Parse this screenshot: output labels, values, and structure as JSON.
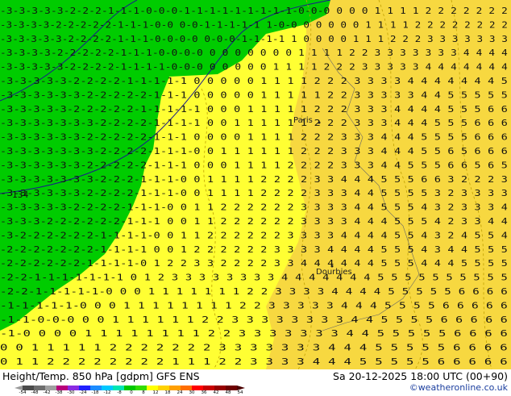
{
  "map": {
    "rows": [
      "-3-3-3-3-3-2-2-2-1-1-1-0-0-0-1-1-1-1-1-1-1-1-1-0-0-0 0 0 0 1 1 1 1 2 2 2 2 2 2 2",
      "-3-3-3-3-2-2-2-2-2-1-1-1-0-0 0-0-1-1-1-1-1 1-0-0 0 0 0 0 0 1 1 1 1 2 2 2 2 2 2 2 2",
      "-3-3-3-3-3-2-2-2-2-1-1-1-0-0-0-0 0-0-0-1-1-1-1 1 0 0 0 0 1 1 1 2 2 2 3 3 3 3 3 3 3",
      "-3-3-3-3-2-2-2-2-2-1-1-1-0-0-0-0 0 0 0 0 0 0 0 1 1 1 1 2 2 3 3 3 3 3 3 3 4 4 4 4",
      "-3-3-3-3-3-2-2-2-2-1-1-1-1-0-0-0 0 0 0 0 0 1 1 1 1 2 2 2 3 3 3 3 3 4 4 4 4 4 4 4",
      "-3-3-3-3-3-2-2-2-2-1-1-1-1-1 0 0 0 0 0 1 1 1 1 2 2 2 3 3 3 3 4 4 4 4 4 4 4 5",
      "-3-3-3-3-3-3-2-2-2-2-2-1-1-1 0 0 0 0 0 1 1 1 1 1 2 2 3 3 3 3 3 4 4 5 5 5 5 5",
      "-3-3-3-3-3-2-2-2-2-2-1-1-1-1-1 0 0 0 1 1 1 1 1 2 2 2 3 3 3 4 4 4 4 5 5 5 6 6",
      "-3-3-3-3-3-3-3-2-2-2-2-1-1-1-1 0 0 1 1 1 1 1 1 2 2 2 3 3 3 4 4 4 5 5 5 6 6 6",
      "-3-3-3-3-3-3-2-2-2-2-2-1-1-1 0 0 0 0 1 1 1 1 2 2 2 3 3 3 4 4 4 5 5 5 5 6 6 6",
      "-3-3-3-3-3-3-3-2-2-2-2-1-1-1-0 0 1 1 1 1 1 1 2 2 2 3 3 3 4 4 4 5 5 6 5 6 6 6",
      "-3-3-3-3-3-3-2-2-2-2-2-1-1-1 0 0 0 1 1 1 1 2 2 2 2 3 3 3 4 4 5 5 5 6 6 5 6 5",
      "-3-3-3-3-3-3-3-2-2-2-1-1-1-0 0 1 1 1 1 2 2 2 2 3 3 4 4 4 5 5 5 6 6 3 2 2 2 3",
      "-3-3-3-3-3-3-2-2-2-2-1-1-1-0 0 1 1 1 1 2 2 2 2 3 3 3 4 4 5 5 5 5 3 2 3 3 3 3",
      "-3-3-3-3-3-2-2-2-2-1-1-1-0 0 1 1 2 2 2 2 2 2 3 3 3 3 4 4 5 5 5 4 3 2 3 3 3 4",
      "-3-3-3-2-2-2-2-2-2-1-1-1 0 0 1 1 2 2 2 2 2 2 3 3 3 3 4 4 4 5 5 5 4 2 3 3 4 4",
      "-3-2-2-2-2-2-2-1-1-1-1-0 0 1 1 2 2 2 2 2 2 3 3 3 3 4 4 4 4 5 5 4 3 2 4 5 5 4",
      "-2-2-2-2-2-2-2-1-1-1-1 0 0 1 2 2 2 2 2 2 3 3 3 3 4 4 4 4 5 5 5 4 3 4 4 5 5 5",
      "-2-2-2-2-2-2-1-1-1-1-0 1 2 2 3 3 2 2 2 2 3 3 4 4 4 4 4 4 5 5 5 4 4 4 5 5 5 5",
      "-2-2-1-1-1-1-1-1-1 0 1 2 3 3 3 3 3 3 3 3 4 4 4 4 4 4 4 5 5 5 5 5 5 5 5 5 5",
      "-2-2-1-1-1-1-1-0 0 0 1 1 1 1 1 1 1 2 2 3 3 3 3 4 4 4 4 5 5 5 5 5 6 6 6 6",
      "-1-1-1-1-1-0 0 0 1 1 1 1 1 1 1 1 2 2 3 3 3 3 3 4 4 4 5 5 5 5 6 6 6 6 6",
      "-1-1-0-0-0 0 0 1 1 1 1 1 1 2 2 3 3 3 3 3 3 3 3 4 4 5 5 5 5 6 6 6 6 6",
      "-1-0 0 0 0 1 1 1 1 1 1 1 1 2 2 3 3 3 3 3 3 3 4 4 5 5 5 5 5 6 6 6 6",
      "0 0 1 1 1 1 1 2 2 2 2 2 2 2 3 3 3 3 3 3 3 4 4 4 5 5 5 5 5 6 6 6 6",
      "0 1 1 2 2 2 2 2 2 2 2 1 1 1 2 2 3 3 3 3 4 4 4 5 5 5 5 5 6 6 6 6 6",
      "1 1 1 2 2 2 2 2 2 2 1 1 2 3 3 4 4 4 4 4 4 5 5 5 5 5 5 6 6 6 6 6 6"
    ],
    "places": [
      {
        "name": "Paris",
        "label": "Paris"
      },
      {
        "name": "Dourbies",
        "label": "Dourbies"
      }
    ],
    "isoline_label": "134",
    "colors": {
      "cold_region": "#00cc00",
      "warm_region": "#ffff33",
      "warmer_region": "#f7d840",
      "contour": "#1a1a8c",
      "dashed_contour": "#c0a000"
    }
  },
  "footer": {
    "title": "Height/Temp. 850 hPa [gdpm] GFS ENS",
    "time": "Sa 20-12-2025 18:00 UTC (00+90)",
    "credit": "©weatheronline.co.uk",
    "colorbar_labels": [
      "-54",
      "-48",
      "-42",
      "-38",
      "-30",
      "-24",
      "-18",
      "-12",
      "-8",
      "0",
      "8",
      "12",
      "18",
      "24",
      "30",
      "36",
      "42",
      "48",
      "54"
    ],
    "colorbar_colors": [
      "#4b4b4b",
      "#6e6e6e",
      "#a0a0a0",
      "#b8007a",
      "#8a2be2",
      "#2020ff",
      "#1c8cff",
      "#00c8ff",
      "#00e6b4",
      "#00c800",
      "#32dc00",
      "#ffff00",
      "#ffd200",
      "#ffa000",
      "#ff6e00",
      "#ff0000",
      "#c80000",
      "#960000",
      "#6e0000"
    ]
  }
}
